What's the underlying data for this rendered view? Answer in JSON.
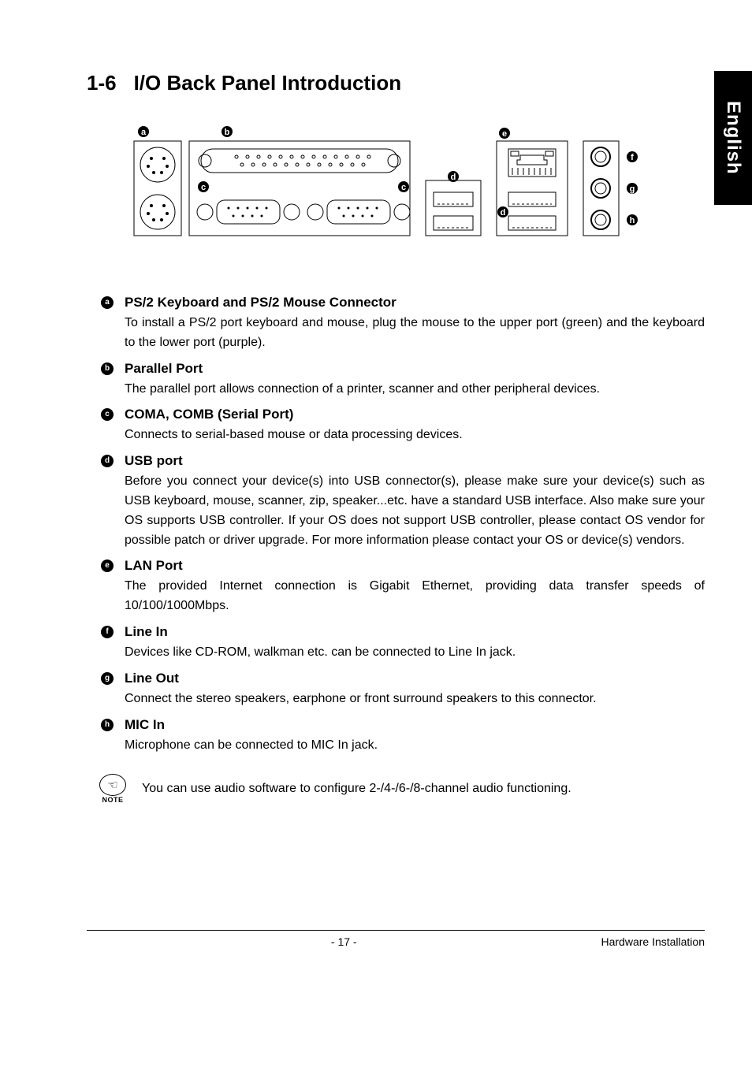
{
  "sideTab": "English",
  "section": {
    "number": "1-6",
    "title": "I/O Back Panel Introduction"
  },
  "diagram": {
    "labels": {
      "a": "a",
      "b": "b",
      "c": "c",
      "d": "d",
      "e": "e",
      "f": "f",
      "g": "g",
      "h": "h"
    }
  },
  "items": [
    {
      "marker": "a",
      "title": "PS/2 Keyboard and PS/2 Mouse Connector",
      "body": "To install a PS/2 port keyboard and mouse, plug the mouse to the upper port (green) and the keyboard to the lower port (purple)."
    },
    {
      "marker": "b",
      "title": "Parallel Port",
      "body": "The parallel port allows connection of a printer, scanner and other peripheral devices."
    },
    {
      "marker": "c",
      "title": "COMA, COMB (Serial Port)",
      "body": "Connects to serial-based mouse or data processing devices."
    },
    {
      "marker": "d",
      "title": "USB port",
      "body": "Before you connect your device(s) into USB connector(s), please make sure your device(s) such as USB keyboard, mouse, scanner, zip, speaker...etc. have a standard USB interface. Also make sure your OS supports USB controller. If your OS does not support USB controller, please contact OS vendor for possible patch or driver upgrade. For more information please contact your OS or device(s) vendors."
    },
    {
      "marker": "e",
      "title": "LAN Port",
      "body": "The provided Internet connection is Gigabit Ethernet, providing data transfer speeds of 10/100/1000Mbps."
    },
    {
      "marker": "f",
      "title": "Line In",
      "body": "Devices like CD-ROM, walkman etc. can be connected to Line In jack."
    },
    {
      "marker": "g",
      "title": "Line Out",
      "body": "Connect the stereo speakers, earphone or front surround speakers to this connector."
    },
    {
      "marker": "h",
      "title": "MIC In",
      "body": "Microphone can be connected to MIC In jack."
    }
  ],
  "note": {
    "label": "NOTE",
    "text": "You can use audio software to configure 2-/4-/6-/8-channel audio functioning."
  },
  "footer": {
    "page": "- 17 -",
    "section": "Hardware Installation"
  }
}
